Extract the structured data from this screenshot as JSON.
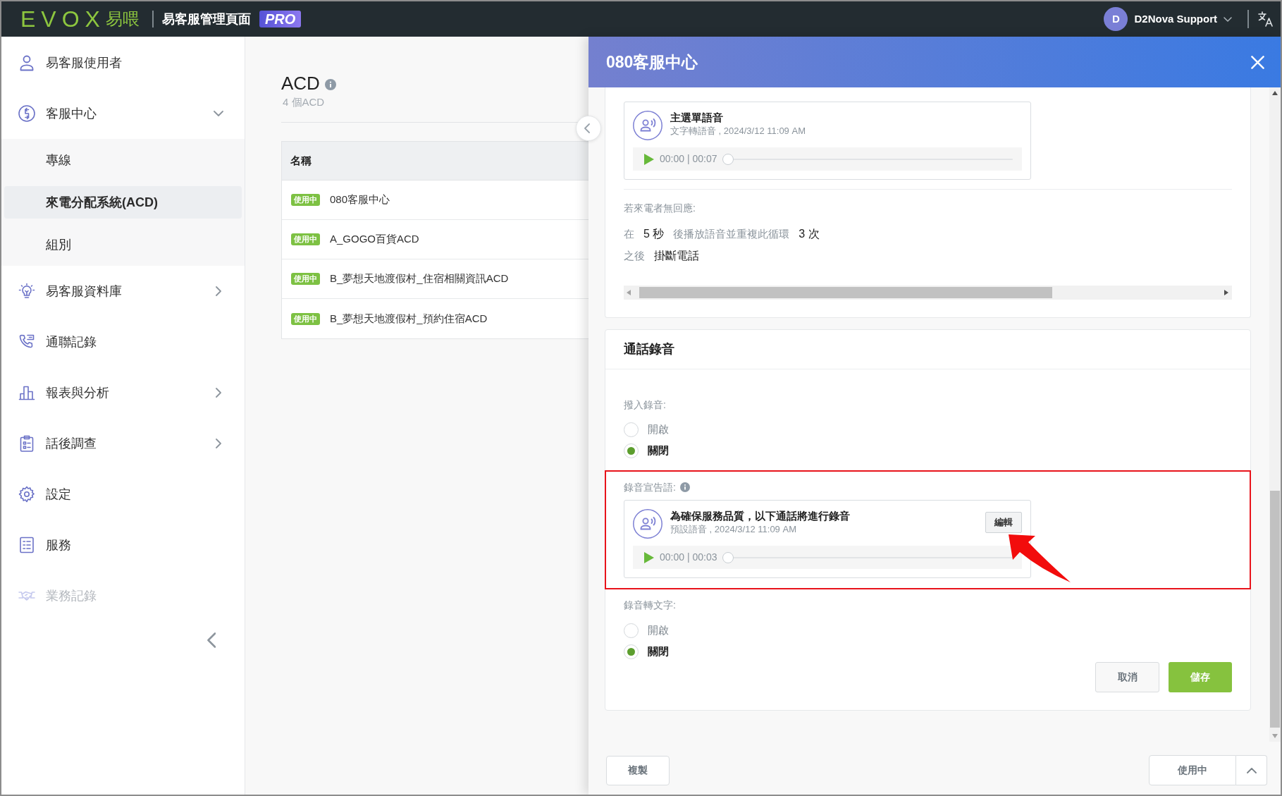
{
  "topbar": {
    "logo": "EVOX",
    "logo_cjk": "易喂",
    "title": "易客服管理頁面",
    "edition": "PRO",
    "user": {
      "initial": "D",
      "name": "D2Nova Support"
    }
  },
  "sidebar": {
    "items": [
      {
        "label": "易客服使用者",
        "kind": "link",
        "disabled": false
      },
      {
        "label": "客服中心",
        "kind": "group",
        "expanded": true,
        "disabled": false,
        "children": [
          {
            "label": "專線",
            "selected": false
          },
          {
            "label": "來電分配系統(ACD)",
            "selected": true
          },
          {
            "label": "組別",
            "selected": false
          }
        ]
      },
      {
        "label": "易客服資料庫",
        "kind": "group",
        "expanded": false,
        "disabled": false
      },
      {
        "label": "通聯記錄",
        "kind": "link",
        "disabled": false
      },
      {
        "label": "報表與分析",
        "kind": "group",
        "expanded": false,
        "disabled": false
      },
      {
        "label": "話後調查",
        "kind": "group",
        "expanded": false,
        "disabled": false
      },
      {
        "label": "設定",
        "kind": "link",
        "disabled": false
      },
      {
        "label": "服務",
        "kind": "link",
        "disabled": false
      },
      {
        "label": "業務記錄",
        "kind": "link",
        "disabled": true
      }
    ]
  },
  "content": {
    "title": "ACD",
    "subtitle": "4 個ACD",
    "table": {
      "columns": [
        "名稱"
      ],
      "rows": [
        {
          "status": "使用中",
          "name": "080客服中心"
        },
        {
          "status": "使用中",
          "name": "A_GOGO百貨ACD"
        },
        {
          "status": "使用中",
          "name": "B_夢想天地渡假村_住宿相關資訊ACD"
        },
        {
          "status": "使用中",
          "name": "B_夢想天地渡假村_預約住宿ACD"
        }
      ]
    }
  },
  "drawer": {
    "title": "080客服中心",
    "menu_card": {
      "audio": {
        "title": "主選單語音",
        "meta": "文字轉語音 , 2024/3/12 11:09 AM",
        "time": "00:00 | 00:07",
        "level": 0
      },
      "no_response_label": "若來電者無回應:",
      "lines": [
        [
          {
            "kind": "label",
            "text": "在"
          },
          {
            "kind": "value",
            "text": "5 秒"
          },
          {
            "kind": "label",
            "text": "後播放語音並重複此循環"
          },
          {
            "kind": "value",
            "text": "3 次"
          }
        ],
        [
          {
            "kind": "label",
            "text": "之後"
          },
          {
            "kind": "value",
            "text": "掛斷電話"
          }
        ]
      ]
    },
    "recording_card": {
      "title": "通話錄音",
      "inbound_recording": {
        "label": "撥入錄音:",
        "options": [
          {
            "label": "開啟",
            "selected": false
          },
          {
            "label": "關閉",
            "selected": true
          }
        ]
      },
      "announcement": {
        "label": "錄音宣告語:",
        "highlighted": true,
        "audio": {
          "title": "為確保服務品質，以下通話將進行錄音",
          "meta": "預設語音 , 2024/3/12 11:09 AM",
          "edit_button": "編輯",
          "time": "00:00 | 00:03",
          "level": 0
        }
      },
      "transcription": {
        "label": "錄音轉文字:",
        "options": [
          {
            "label": "開啟",
            "selected": false
          },
          {
            "label": "關閉",
            "selected": true
          }
        ]
      },
      "buttons": [
        {
          "label": "取消",
          "kind": "secondary"
        },
        {
          "label": "儲存",
          "kind": "primary"
        }
      ]
    },
    "footer": {
      "copy_button": "複製",
      "status_button": "使用中"
    }
  }
}
